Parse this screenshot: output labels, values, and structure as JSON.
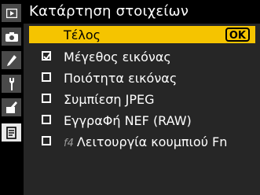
{
  "title": "Κατάρτηση στοιχείων",
  "sidebar": {
    "tabs": [
      {
        "icon": "playback-icon"
      },
      {
        "icon": "camera-icon"
      },
      {
        "icon": "pencil-icon"
      },
      {
        "icon": "wrench-icon"
      },
      {
        "icon": "retouch-icon"
      },
      {
        "icon": "my-menu-icon"
      }
    ],
    "active_index": 5
  },
  "menu": {
    "done_label": "Τέλος",
    "ok_label": "OK",
    "items": [
      {
        "label": "Μέγεθος εικόνας",
        "checked": true
      },
      {
        "label": "Ποιότητα εικόνας",
        "checked": false
      },
      {
        "label": "Συμπίεση JPEG",
        "checked": false
      },
      {
        "label": "ΕγγραΦή NEF (RAW)",
        "checked": false
      },
      {
        "code": "f4",
        "label": "Λειτουργία κουμπιού Fn",
        "checked": false
      }
    ]
  },
  "colors": {
    "selection": "#f5c400",
    "panel": "#262626",
    "tab": "#4a4a4a"
  }
}
